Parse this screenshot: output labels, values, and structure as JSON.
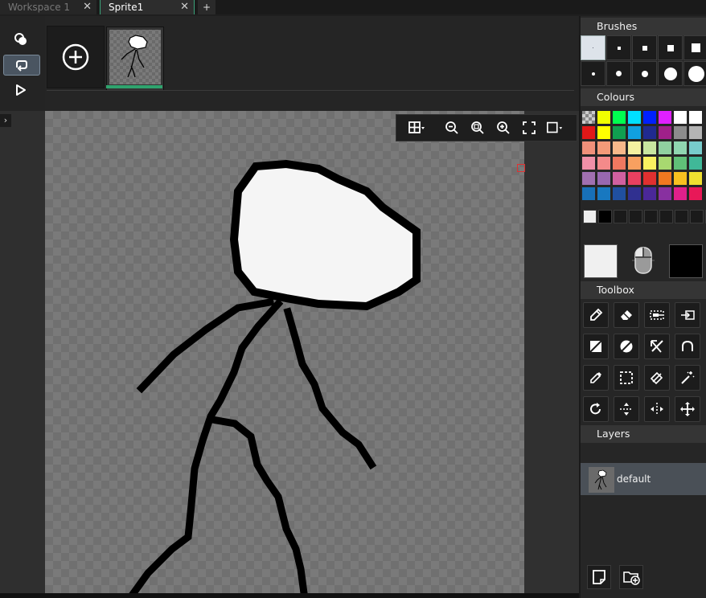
{
  "tabs": [
    {
      "label": "Workspace 1",
      "close": "✕"
    },
    {
      "label": "Sprite1",
      "close": "✕"
    }
  ],
  "add_tab_label": "+",
  "left_tools": {
    "play_icon": "play-icon",
    "loop_icon": "loop-icon",
    "onion_icon": "onion-skin-icon"
  },
  "frames": [
    {
      "name": "frame-1"
    }
  ],
  "panels": {
    "brushes": "Brushes",
    "colours": "Colours",
    "toolbox": "Toolbox",
    "layers": "Layers"
  },
  "brush_rows": [
    {
      "shape": "square",
      "sizes": [
        1,
        2,
        4,
        6,
        9
      ],
      "selected": 0
    },
    {
      "shape": "circle",
      "sizes": [
        2,
        5,
        6,
        14,
        18
      ]
    }
  ],
  "palette": [
    [
      "#a0a0a0",
      "#f0ff00",
      "#00ff50",
      "#00e0ff",
      "#0020ff",
      "#e020ff",
      "#ffffff",
      "#ffffff"
    ],
    [
      "#e01818",
      "#ffff00",
      "#10a050",
      "#10a0e0",
      "#202a90",
      "#a0208a",
      "#8c8c8c",
      "#b4b4b4"
    ],
    [
      "#f0907a",
      "#f49a78",
      "#f8b88a",
      "#f4f0a0",
      "#c8e6a0",
      "#90d0a0",
      "#90d6b0",
      "#78cccc"
    ],
    [
      "#f090a8",
      "#f48a8a",
      "#f07860",
      "#f8a060",
      "#f8f060",
      "#a8d870",
      "#60c078",
      "#40b898"
    ],
    [
      "#a070b0",
      "#9868b0",
      "#d060a0",
      "#e84060",
      "#e03030",
      "#f07820",
      "#f8c020",
      "#f0e030"
    ],
    [
      "#1870b8",
      "#1878c0",
      "#2050a0",
      "#303090",
      "#4a2898",
      "#8830a0",
      "#e0208a",
      "#e81858"
    ]
  ],
  "recent_colours": [
    "#eeeeee",
    "#000000",
    "#1a1a1a",
    "#1a1a1a",
    "#1a1a1a",
    "#1a1a1a",
    "#1a1a1a",
    "#1a1a1a",
    "#1a1a1a"
  ],
  "primary_colour": "#f0f0f0",
  "secondary_colour": "#000000",
  "tools": [
    [
      "pencil-icon",
      "eraser-icon",
      "copy-selection-icon",
      "paste-selection-icon"
    ],
    [
      "fill-rect-icon",
      "fill-ellipse-icon",
      "line-icon",
      "arc-icon"
    ],
    [
      "colour-picker-icon",
      "rect-select-icon",
      "fill-bucket-icon",
      "magic-wand-icon"
    ],
    [
      "rotate-icon",
      "flip-vertical-icon",
      "flip-horizontal-icon",
      "move-icon"
    ]
  ],
  "layers": [
    {
      "name": "default"
    }
  ],
  "zoom_bar": [
    "grid-icon",
    "zoom-out-icon",
    "zoom-reset-icon",
    "zoom-in-icon",
    "fit-screen-icon",
    "background-icon"
  ],
  "accent": "#2fa36e"
}
